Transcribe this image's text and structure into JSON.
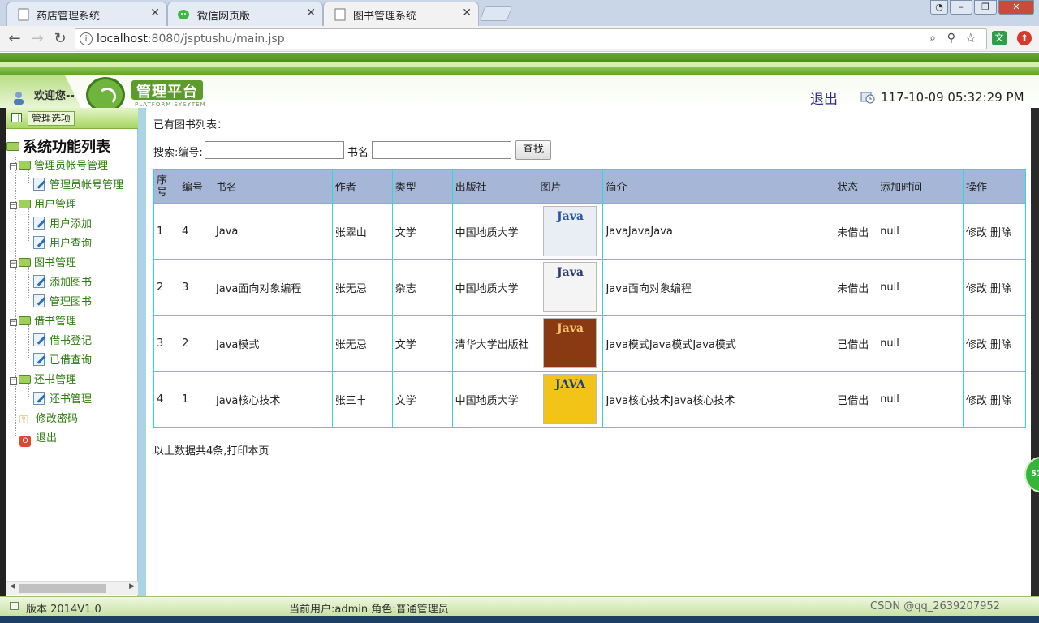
{
  "browser": {
    "tabs": [
      {
        "title": "药店管理系统",
        "active": false
      },
      {
        "title": "微信网页版",
        "active": false
      },
      {
        "title": "图书管理系统",
        "active": true
      }
    ],
    "close_glyph": "✕",
    "url_host": "localhost",
    "url_rest": ":8080/jsptushu/main.jsp",
    "back": "←",
    "forward": "→",
    "reload": "↻",
    "zoom_icon": "⌕",
    "pin_icon": "⚲",
    "star_icon": "☆",
    "ext1": "文",
    "ext2": "⬆",
    "win_min": "–",
    "win_max": "❐",
    "win_close": "✕"
  },
  "header": {
    "welcome": "欢迎您--",
    "platform_title": "管理平台",
    "platform_sub": "PLATFORM SYSYTEM",
    "logout": "退出",
    "datetime": "117-10-09 05:32:29 PM",
    "colors": {
      "green_dark": "#4f8e1a",
      "green_light": "#a8d66a"
    }
  },
  "sidebar": {
    "header_button": "管理选项",
    "title": "系统功能列表",
    "groups": [
      {
        "label": "管理员帐号管理",
        "items": [
          "管理员帐号管理"
        ]
      },
      {
        "label": "用户管理",
        "items": [
          "用户添加",
          "用户查询"
        ]
      },
      {
        "label": "图书管理",
        "items": [
          "添加图书",
          "管理图书"
        ]
      },
      {
        "label": "借书管理",
        "items": [
          "借书登记",
          "已借查询"
        ]
      },
      {
        "label": "还书管理",
        "items": [
          "还书管理"
        ]
      }
    ],
    "change_password": "修改密码",
    "exit": "退出",
    "exit_icon_text": "O",
    "expand_glyph": "−"
  },
  "main": {
    "list_label": "已有图书列表：",
    "search": {
      "label_id": "搜索:编号:",
      "label_name": "书名",
      "button": "查找",
      "id_value": "",
      "name_value": ""
    },
    "table": {
      "headers": [
        "序号",
        "编号",
        "书名",
        "作者",
        "类型",
        "出版社",
        "图片",
        "简介",
        "状态",
        "添加时间",
        "操作"
      ],
      "rows": [
        {
          "seq": "1",
          "id": "4",
          "name": "Java",
          "author": "张翠山",
          "type": "文学",
          "publisher": "中国地质大学",
          "cover": "Java",
          "cover_color": "#e9eef5",
          "cover_text_color": "#2855a3",
          "intro": "JavaJavaJava",
          "status": "未借出",
          "added": "null",
          "edit": "修改",
          "del": "删除"
        },
        {
          "seq": "2",
          "id": "3",
          "name": "Java面向对象编程",
          "author": "张无忌",
          "type": "杂志",
          "publisher": "中国地质大学",
          "cover": "Java",
          "cover_color": "#f4f4f4",
          "cover_text_color": "#2a3e6e",
          "intro": "Java面向对象编程",
          "status": "未借出",
          "added": "null",
          "edit": "修改",
          "del": "删除"
        },
        {
          "seq": "3",
          "id": "2",
          "name": "Java模式",
          "author": "张无忌",
          "type": "文学",
          "publisher": "清华大学出版社",
          "cover": "Java",
          "cover_color": "#8a3a12",
          "cover_text_color": "#f6c26a",
          "intro": "Java模式Java模式Java模式",
          "status": "已借出",
          "added": "null",
          "edit": "修改",
          "del": "删除"
        },
        {
          "seq": "4",
          "id": "1",
          "name": "Java核心技术",
          "author": "张三丰",
          "type": "文学",
          "publisher": "中国地质大学",
          "cover": "JAVA",
          "cover_color": "#f2c418",
          "cover_text_color": "#1b3f8f",
          "intro": "Java核心技术Java核心技术",
          "status": "已借出",
          "added": "null",
          "edit": "修改",
          "del": "删除"
        }
      ]
    },
    "summary": "以上数据共4条,打印本页",
    "float_badge": "51"
  },
  "footer": {
    "version": "版本 2014V1.0",
    "current_user": "当前用户:admin  角色:普通管理员",
    "copyright": "CSDN @qq_2639207952"
  }
}
